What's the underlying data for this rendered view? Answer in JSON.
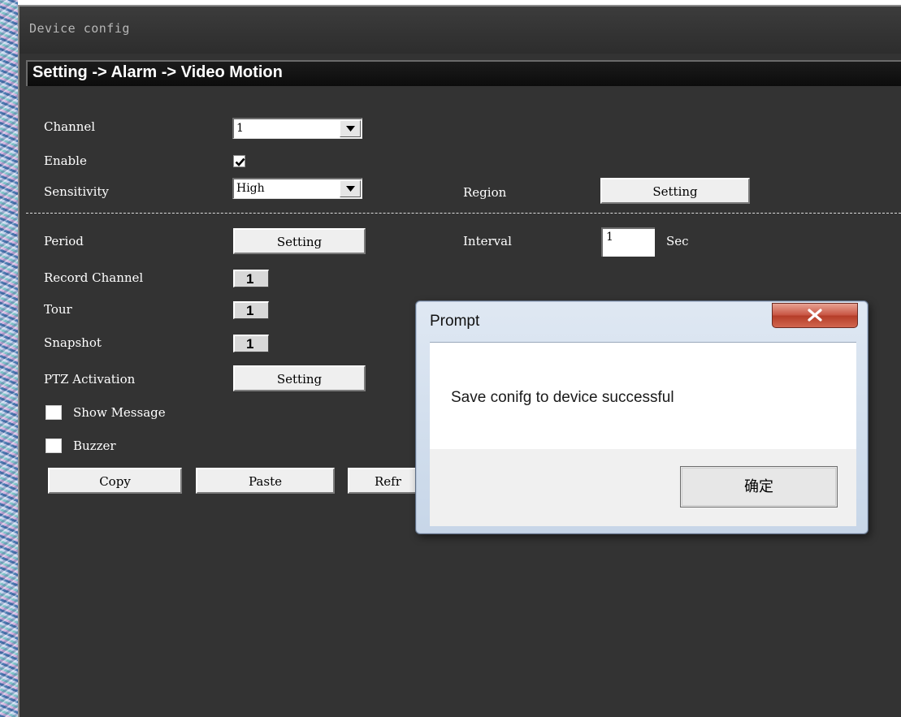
{
  "window": {
    "title": "Device config"
  },
  "breadcrumb": "Setting -> Alarm -> Video Motion",
  "form": {
    "channel_label": "Channel",
    "channel_value": "1",
    "enable_label": "Enable",
    "enable_checked": true,
    "sensitivity_label": "Sensitivity",
    "sensitivity_value": "High",
    "region_label": "Region",
    "region_button": "Setting",
    "period_label": "Period",
    "period_button": "Setting",
    "interval_label": "Interval",
    "interval_value": "1",
    "interval_unit": "Sec",
    "record_channel_label": "Record Channel",
    "record_channel_value": "1",
    "tour_label": "Tour",
    "tour_value": "1",
    "snapshot_label": "Snapshot",
    "snapshot_value": "1",
    "ptz_label": "PTZ Activation",
    "ptz_button": "Setting",
    "show_message_label": "Show Message",
    "show_message_checked": false,
    "buzzer_label": "Buzzer",
    "buzzer_checked": false
  },
  "actions": {
    "copy": "Copy",
    "paste": "Paste",
    "refresh_partial": "Refr"
  },
  "dialog": {
    "title": "Prompt",
    "message": "Save conifg to device successful",
    "ok_button": "确定",
    "close_icon": "close-icon"
  },
  "colors": {
    "window_bg": "#333333",
    "breadcrumb_bg": "#0c0c0c",
    "close_button": "#c75341"
  }
}
